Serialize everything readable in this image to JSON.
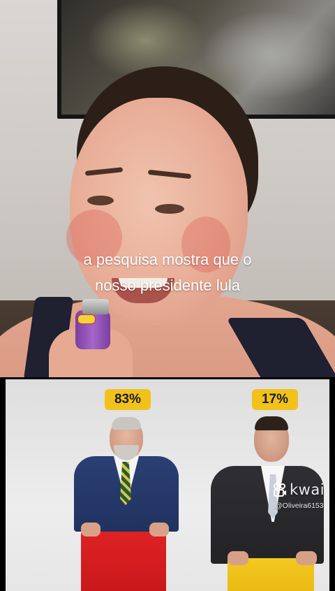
{
  "video": {
    "caption_line1": "a pesquisa mostra que o",
    "caption_line2": "nosso presidente lula"
  },
  "poll": {
    "left_percent": "83%",
    "right_percent": "17%",
    "left_podium_color": "#de2224",
    "right_podium_color": "#f3c81f",
    "badge_color": "#f2c21c"
  },
  "watermark": {
    "brand": "kwai",
    "handle": "@Oliveira6153",
    "icon": "kwai-logo-icon"
  }
}
